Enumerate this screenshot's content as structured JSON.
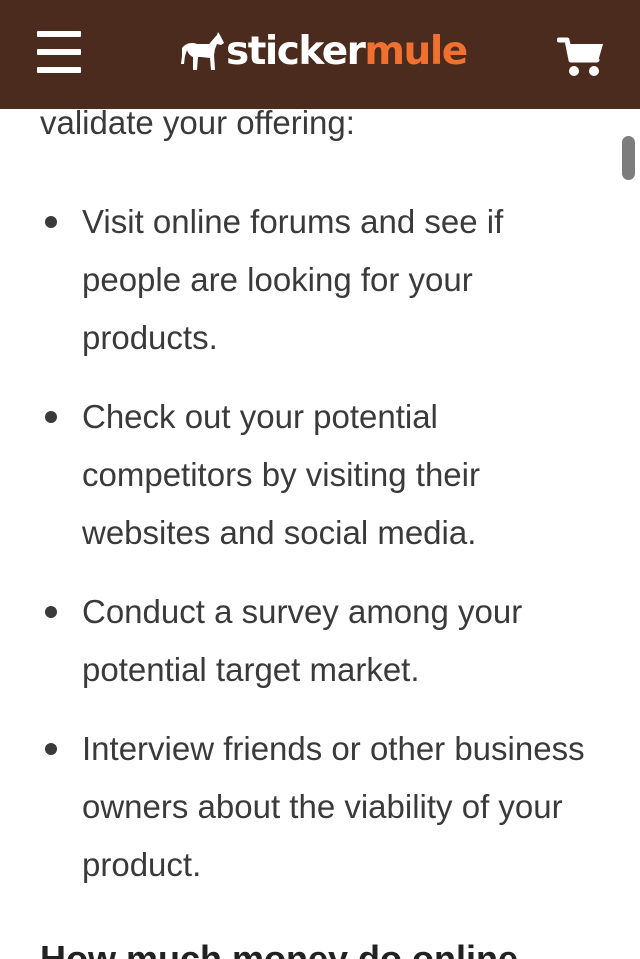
{
  "colors": {
    "header_bg": "#4a2b1d",
    "logo_accent": "#f0702f",
    "body_text": "#3a3a3a"
  },
  "header": {
    "menu_icon": "hamburger-menu-icon",
    "logo_word_1": "sticker",
    "logo_word_2": "mule",
    "logo_icon": "mule-icon",
    "cart_icon": "shopping-cart-icon"
  },
  "article": {
    "intro_text": "validate your offering:",
    "bullets": [
      {
        "text": "Visit online forums and see if people are looking for your products."
      },
      {
        "text": "Check out your potential competitors by visiting their websites and social media."
      },
      {
        "text": "Conduct a survey among your potential target market."
      },
      {
        "text": "Interview friends or other business owners about the viability of your product."
      }
    ],
    "next_heading": "How much money do online"
  }
}
